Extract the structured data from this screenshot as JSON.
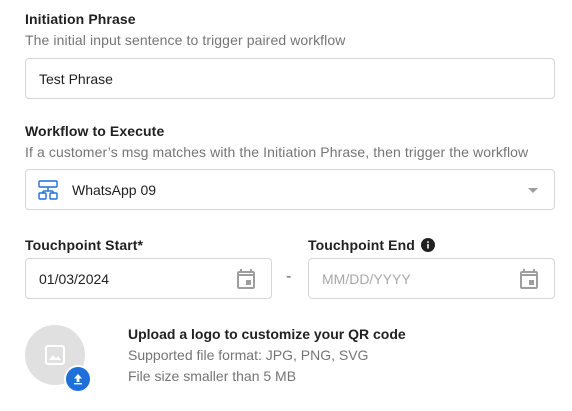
{
  "initiation": {
    "label": "Initiation Phrase",
    "hint": "The initial input sentence to trigger paired workflow",
    "value": "Test Phrase"
  },
  "workflow": {
    "label": "Workflow to Execute",
    "hint": "If a customer’s msg matches with the Initiation Phrase, then trigger the workflow",
    "selected": "WhatsApp 09"
  },
  "touchpoint_start": {
    "label": "Touchpoint Start*",
    "value": "01/03/2024"
  },
  "touchpoint_end": {
    "label": "Touchpoint End",
    "placeholder": "MM/DD/YYYY"
  },
  "separator": "-",
  "upload": {
    "title": "Upload a logo to customize your QR code",
    "formats": "Supported file format: JPG, PNG, SVG",
    "size": "File size smaller than 5 MB"
  },
  "colors": {
    "accent": "#1e6fd9",
    "border": "#d6d6d6",
    "hint": "#757575",
    "placeholder_bg": "#e0e0e0"
  }
}
